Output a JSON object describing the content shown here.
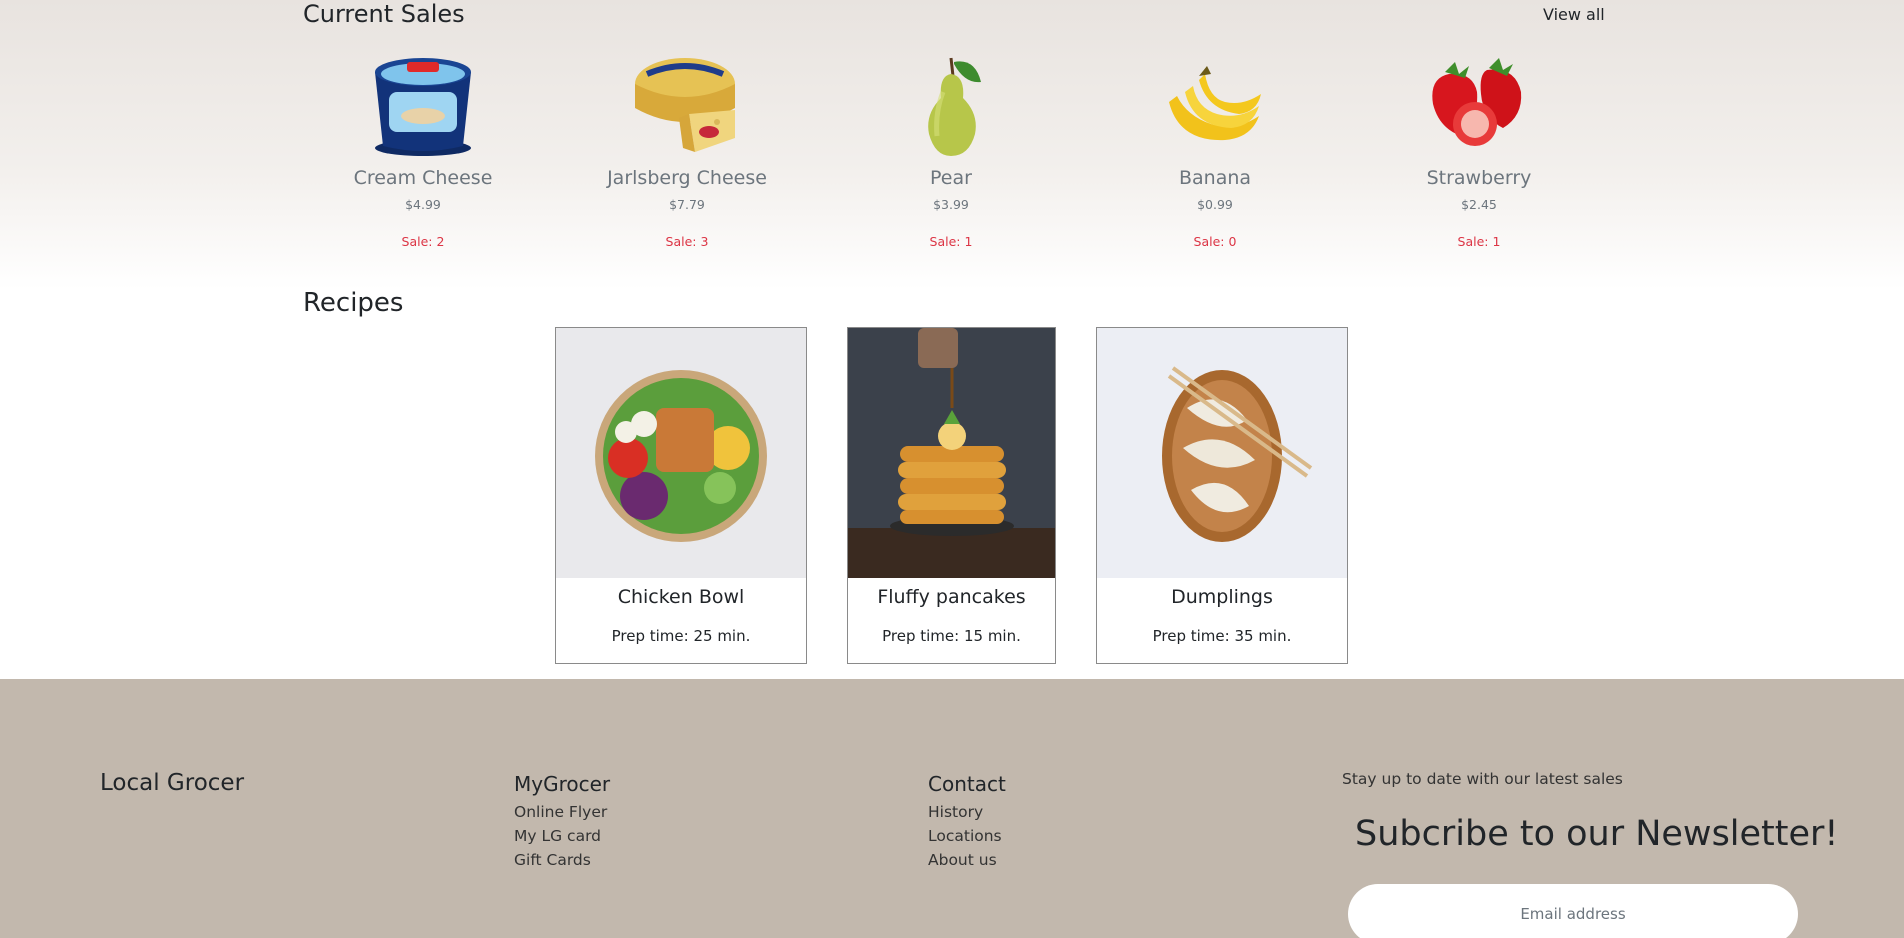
{
  "sales": {
    "title": "Current Sales",
    "view_all": "View all",
    "products": [
      {
        "name": "Cream Cheese",
        "price": "$4.99",
        "sale": "Sale: 2"
      },
      {
        "name": "Jarlsberg Cheese",
        "price": "$7.79",
        "sale": "Sale: 3"
      },
      {
        "name": "Pear",
        "price": "$3.99",
        "sale": "Sale: 1"
      },
      {
        "name": "Banana",
        "price": "$0.99",
        "sale": "Sale: 0"
      },
      {
        "name": "Strawberry",
        "price": "$2.45",
        "sale": "Sale: 1"
      }
    ]
  },
  "recipes": {
    "title": "Recipes",
    "items": [
      {
        "title": "Chicken Bowl",
        "prep": "Prep time: 25 min."
      },
      {
        "title": "Fluffy pancakes",
        "prep": "Prep time: 15 min."
      },
      {
        "title": "Dumplings",
        "prep": "Prep time: 35 min."
      }
    ]
  },
  "footer": {
    "brand": "Local Grocer",
    "mygrocer": {
      "heading": "MyGrocer",
      "links": [
        "Online Flyer",
        "My LG card",
        "Gift Cards"
      ]
    },
    "contact": {
      "heading": "Contact",
      "links": [
        "History",
        "Locations",
        "About us"
      ]
    },
    "newsletter": {
      "tagline": "Stay up to date with our latest sales",
      "title": "Subcribe to our Newsletter!",
      "email_placeholder": "Email address"
    }
  },
  "colors": {
    "sale_red": "#dc3545",
    "footer_bg": "#c2b8ad",
    "muted_text": "#6c757d"
  }
}
